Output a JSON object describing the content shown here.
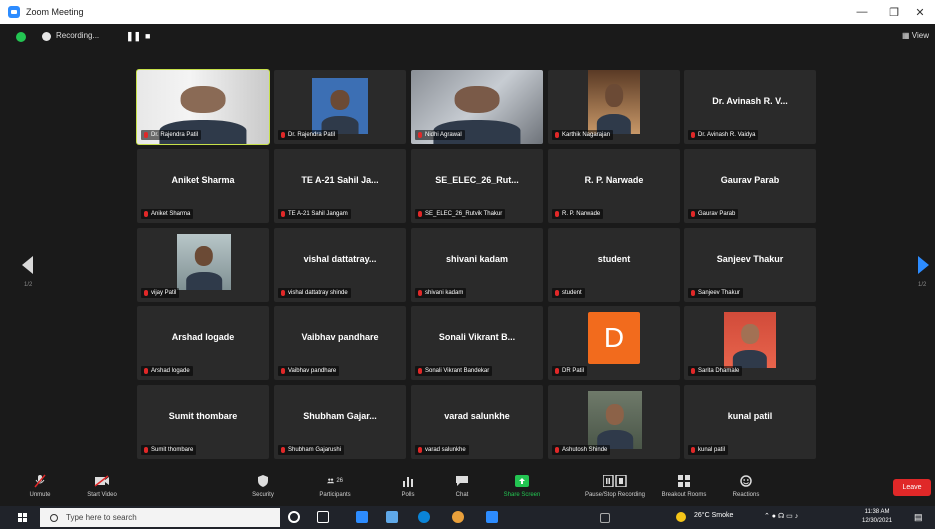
{
  "window": {
    "title": "Zoom Meeting",
    "minimize": "—",
    "restore": "❐",
    "close": "✕"
  },
  "meeting_bar": {
    "recording_label": "Recording...",
    "pause_glyph": "❚❚",
    "stop_glyph": "■",
    "view_label": "View"
  },
  "grid": {
    "tiles": [
      {
        "display_name": "",
        "label": "Dr. Rajendra Patil",
        "has_video": true,
        "active": true
      },
      {
        "display_name": "",
        "label": "Dr. Rajendra Patil",
        "has_video": true
      },
      {
        "display_name": "",
        "label": "Nidhi Agrawal",
        "has_video": true
      },
      {
        "display_name": "",
        "label": "Karthik Nagarajan",
        "has_video": true
      },
      {
        "display_name": "Dr. Avinash R. V...",
        "label": "Dr. Avinash R. Vaidya"
      },
      {
        "display_name": "Aniket Sharma",
        "label": "Aniket Sharma"
      },
      {
        "display_name": "TE A-21 Sahil Ja...",
        "label": "TE A-21 Sahil Jangam"
      },
      {
        "display_name": "SE_ELEC_26_Rut...",
        "label": "SE_ELEC_26_Rutvik Thakur"
      },
      {
        "display_name": "R. P. Narwade",
        "label": "R. P. Narwade"
      },
      {
        "display_name": "Gaurav Parab",
        "label": "Gaurav Parab"
      },
      {
        "display_name": "",
        "label": "vijay Patil",
        "has_video": true
      },
      {
        "display_name": "vishal dattatray...",
        "label": "vishal dattatray shinde"
      },
      {
        "display_name": "shivani kadam",
        "label": "shivani kadam"
      },
      {
        "display_name": "student",
        "label": "student"
      },
      {
        "display_name": "Sanjeev Thakur",
        "label": "Sanjeev Thakur"
      },
      {
        "display_name": "Arshad logade",
        "label": "Arshad logade"
      },
      {
        "display_name": "Vaibhav pandhare",
        "label": "Vaibhav pandhare"
      },
      {
        "display_name": "Sonali Vikrant B...",
        "label": "Sonali Vikrant Bandekar"
      },
      {
        "display_name": "",
        "label": "DR Patil",
        "avatar_letter": "D"
      },
      {
        "display_name": "",
        "label": "Sarita Dhamale",
        "has_video": true
      },
      {
        "display_name": "Sumit thombare",
        "label": "Sumit thombare"
      },
      {
        "display_name": "Shubham Gajar...",
        "label": "Shubham Gajarushi"
      },
      {
        "display_name": "varad salunkhe",
        "label": "varad salunkhe"
      },
      {
        "display_name": "",
        "label": "Ashutosh Shinde",
        "has_video": true
      },
      {
        "display_name": "kunal patil",
        "label": "kunal patil"
      }
    ],
    "page_left": "1/2",
    "page_right": "1/2"
  },
  "toolbar": {
    "unmute": "Unmute",
    "start_video": "Start Video",
    "security": "Security",
    "participants": "Participants",
    "participants_count": "26",
    "polls": "Polls",
    "chat": "Chat",
    "share_screen": "Share Screen",
    "pause_recording": "Pause/Stop Recording",
    "breakout_rooms": "Breakout Rooms",
    "reactions": "Reactions",
    "leave": "Leave"
  },
  "taskbar": {
    "search_placeholder": "Type here to search",
    "weather": "26°C Smoke",
    "clock_time": "11:38 AM",
    "clock_date": "12/30/2021"
  },
  "colors": {
    "accent": "#2d8cff",
    "leave": "#e02828",
    "share": "#23c552",
    "active_speaker": "#c7e04a",
    "avatar": "#f26b1d"
  }
}
